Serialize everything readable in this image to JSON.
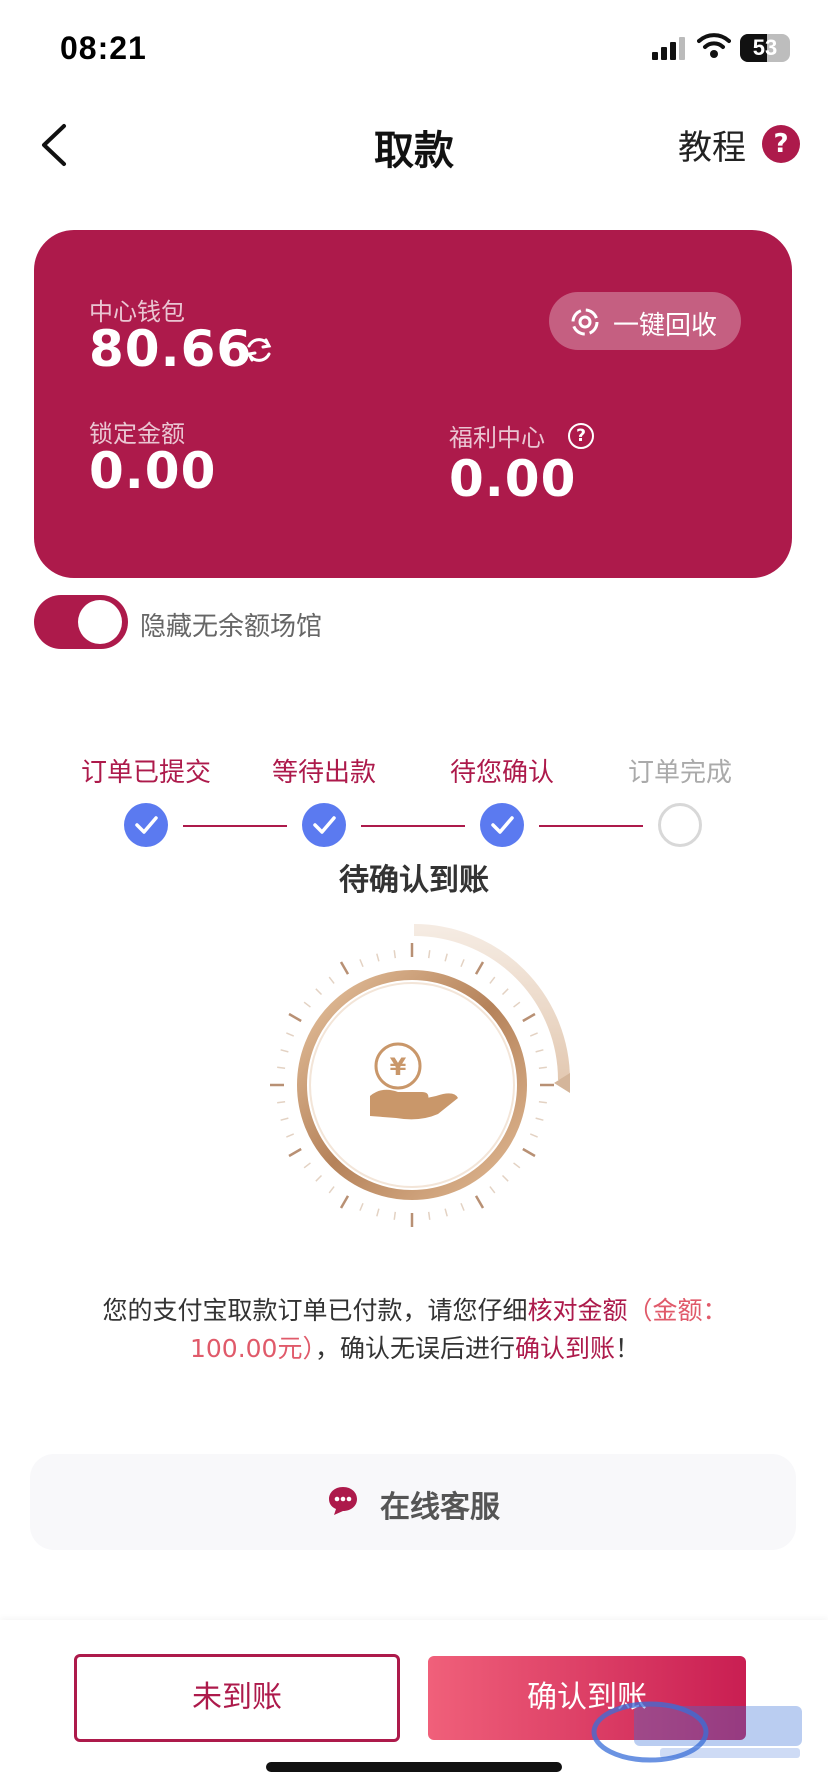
{
  "status_bar": {
    "time": "08:21",
    "battery": "53",
    "battery_level": 0.53
  },
  "header": {
    "title": "取款",
    "tutorial_label": "教程",
    "help_symbol": "?"
  },
  "wallet": {
    "center_label": "中心钱包",
    "center_value": "80.66",
    "recycle_label": "一键回收",
    "locked_label": "锁定金额",
    "locked_value": "0.00",
    "welfare_label": "福利中心",
    "welfare_help_symbol": "?",
    "welfare_value": "0.00"
  },
  "toggle": {
    "label": "隐藏无余额场馆",
    "on": true
  },
  "steps": [
    {
      "label": "订单已提交",
      "done": true
    },
    {
      "label": "等待出款",
      "done": true
    },
    {
      "label": "待您确认",
      "done": true
    },
    {
      "label": "订单完成",
      "done": false
    }
  ],
  "status_title": "待确认到账",
  "message": {
    "part1": "您的支付宝取款订单已付款，请您仔细",
    "part2": "核对金额",
    "part3": "（金额：100.00元）",
    "part4": "，确认无误后进行",
    "part5": "确认到账",
    "part6": "！"
  },
  "support": {
    "label": "在线客服"
  },
  "actions": {
    "not_received": "未到账",
    "confirm": "确认到账"
  },
  "colors": {
    "accent": "#ad1a4b",
    "step_done": "#5b7af0",
    "gold": "#c9976a"
  },
  "icons": [
    "signal-icon",
    "wifi-icon",
    "battery-icon",
    "back-icon",
    "help-icon",
    "refresh-icon",
    "recycle-icon",
    "check-icon",
    "coin-hand-icon",
    "chat-icon"
  ]
}
